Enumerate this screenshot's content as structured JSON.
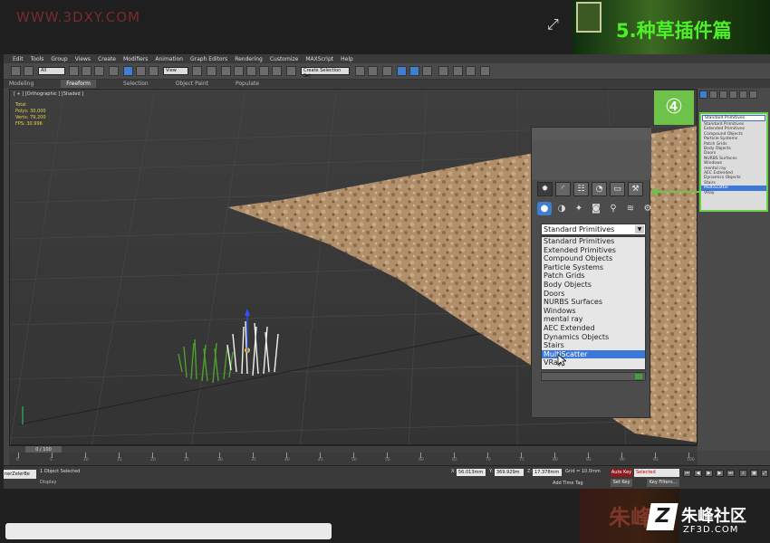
{
  "banner": {
    "watermark": "WWW.3DXY.COM",
    "lesson_title": "5.种草插件篇"
  },
  "menu": [
    "Edit",
    "Tools",
    "Group",
    "Views",
    "Create",
    "Modifiers",
    "Animation",
    "Graph Editors",
    "Rendering",
    "Customize",
    "MAXScript",
    "Help"
  ],
  "toolbar": {
    "selection_filter": "All",
    "view_dropdown": "View",
    "named_sets": "Create Selection Set"
  },
  "ribbon": {
    "tabs": [
      "Modeling",
      "Freeform",
      "Selection",
      "Object Paint",
      "Populate"
    ],
    "active": "Freeform"
  },
  "viewport": {
    "label": "[ + ] [Orthographic ] [Shaded ]",
    "stats": [
      "Total",
      "Polys:  30,000",
      "Verts:  79,200",
      "",
      "FPS:    30.996"
    ]
  },
  "cmd_panel": {
    "selected": "Standard Primitives",
    "items": [
      "Standard Primitives",
      "Extended Primitives",
      "Compound Objects",
      "Particle Systems",
      "Patch Grids",
      "Body Objects",
      "Doors",
      "NURBS Surfaces",
      "Windows",
      "mental ray",
      "AEC Extended",
      "Dynamics Objects",
      "Stairs",
      "MultiScatter",
      "VRay"
    ],
    "highlight": "MultiScatter"
  },
  "step_badge": "④",
  "zoom_panel": {
    "tab_icons": [
      "sun",
      "arc",
      "hierarchy",
      "motion",
      "display",
      "utilities"
    ],
    "sub_icons": [
      "sphere",
      "shapes",
      "light",
      "camera",
      "helper",
      "spacewarp",
      "systems"
    ],
    "selected": "Standard Primitives",
    "items": [
      "Standard Primitives",
      "Extended Primitives",
      "Compound Objects",
      "Particle Systems",
      "Patch Grids",
      "Body Objects",
      "Doors",
      "NURBS Surfaces",
      "Windows",
      "mental ray",
      "AEC Extended",
      "Dynamics Objects",
      "Stairs",
      "MultiScatter",
      "VRay"
    ],
    "highlight": "MultiScatter"
  },
  "timeline": {
    "slider": "0 / 100",
    "ticks": [
      "0",
      "5",
      "10",
      "15",
      "20",
      "25",
      "30",
      "35",
      "40",
      "45",
      "50",
      "55",
      "60",
      "65",
      "70",
      "75",
      "80",
      "85",
      "90",
      "95",
      "100"
    ]
  },
  "status": {
    "left_box": "nerZelerBe",
    "selection_text": "1 Object Selected",
    "prompt_text": "Display",
    "x_label": "X:",
    "x_value": "56.013mm",
    "y_label": "Y:",
    "y_value": "369.929m",
    "z_label": "Z:",
    "z_value": "17.378mm",
    "grid": "Grid = 10.0mm",
    "add_time_tag": "Add Time Tag",
    "auto_key": "Auto Key",
    "set_key": "Set Key",
    "selected_mode": "Selected",
    "key_filters": "Key Filters..."
  },
  "footer": {
    "brand_cn": "朱峰社区",
    "brand_url": "ZF3D.COM",
    "brand_mark": "Z",
    "faint_logo": "朱峰"
  },
  "colors": {
    "accent_green": "#6ec24a",
    "title_green": "#4ef02a",
    "highlight_blue": "#3c78d8"
  }
}
